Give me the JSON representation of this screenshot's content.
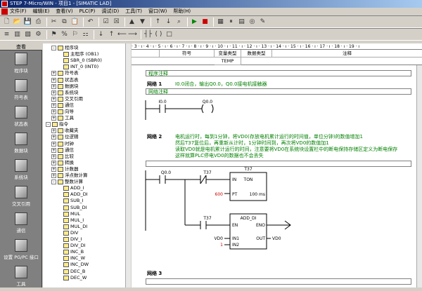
{
  "window": {
    "title": "STEP 7-Micro/WIN - 项目1 - [SIMATIC LAD]"
  },
  "menu": [
    "文件(F)",
    "编辑(E)",
    "查看(V)",
    "PLC(P)",
    "调试(D)",
    "工具(T)",
    "窗口(W)",
    "帮助(H)"
  ],
  "nav": {
    "header": "查看",
    "items": [
      {
        "label": "程序块",
        "icon": "program-block-icon"
      },
      {
        "label": "符号表",
        "icon": "symbol-table-icon"
      },
      {
        "label": "状态表",
        "icon": "status-table-icon"
      },
      {
        "label": "数据块",
        "icon": "data-block-icon"
      },
      {
        "label": "系统块",
        "icon": "system-block-icon"
      },
      {
        "label": "交叉引用",
        "icon": "cross-ref-icon"
      },
      {
        "label": "通信",
        "icon": "comm-icon"
      },
      {
        "label": "设置 PG/PC 接口",
        "icon": "pgpc-icon"
      },
      {
        "label": "工具",
        "icon": "tools-icon"
      }
    ]
  },
  "tree": [
    {
      "label": "程序块",
      "indent": 1,
      "exp": "-"
    },
    {
      "label": "主程序 (OB1)",
      "indent": 2
    },
    {
      "label": "SBR_0 (SBR0)",
      "indent": 2
    },
    {
      "label": "INT_0 (INT0)",
      "indent": 2
    },
    {
      "label": "符号表",
      "indent": 1,
      "exp": "+"
    },
    {
      "label": "状态表",
      "indent": 1,
      "exp": "+"
    },
    {
      "label": "数据块",
      "indent": 1,
      "exp": "+"
    },
    {
      "label": "系统块",
      "indent": 1,
      "exp": "+"
    },
    {
      "label": "交叉引用",
      "indent": 1,
      "exp": "+"
    },
    {
      "label": "通信",
      "indent": 1,
      "exp": "+"
    },
    {
      "label": "向导",
      "indent": 1,
      "exp": "+"
    },
    {
      "label": "工具",
      "indent": 1,
      "exp": "+"
    },
    {
      "label": "指令",
      "indent": 0,
      "exp": "-"
    },
    {
      "label": "收藏夹",
      "indent": 1,
      "exp": "+"
    },
    {
      "label": "位逻辑",
      "indent": 1,
      "exp": "+"
    },
    {
      "label": "时钟",
      "indent": 1,
      "exp": "+"
    },
    {
      "label": "通信",
      "indent": 1,
      "exp": "+"
    },
    {
      "label": "比较",
      "indent": 1,
      "exp": "+"
    },
    {
      "label": "转换",
      "indent": 1,
      "exp": "+"
    },
    {
      "label": "计数器",
      "indent": 1,
      "exp": "+"
    },
    {
      "label": "浮点数计算",
      "indent": 1,
      "exp": "+"
    },
    {
      "label": "整数计算",
      "indent": 1,
      "exp": "-"
    },
    {
      "label": "ADD_I",
      "indent": 2
    },
    {
      "label": "ADD_DI",
      "indent": 2
    },
    {
      "label": "SUB_I",
      "indent": 2
    },
    {
      "label": "SUB_DI",
      "indent": 2
    },
    {
      "label": "MUL",
      "indent": 2
    },
    {
      "label": "MUL_I",
      "indent": 2
    },
    {
      "label": "MUL_DI",
      "indent": 2
    },
    {
      "label": "DIV",
      "indent": 2
    },
    {
      "label": "DIV_I",
      "indent": 2
    },
    {
      "label": "DIV_DI",
      "indent": 2
    },
    {
      "label": "INC_B",
      "indent": 2
    },
    {
      "label": "INC_W",
      "indent": 2
    },
    {
      "label": "INC_DW",
      "indent": 2
    },
    {
      "label": "DEC_B",
      "indent": 2
    },
    {
      "label": "DEC_W",
      "indent": 2
    }
  ],
  "ruler": "· 3 · ı · 4 · ı · 5 · ı · 6 · ı · 7 · ı · 8 · ı · 9 · ı · 10 · ı · 11 · ı · 12 · ı · 13 · ı · 14 · ı · 15 · ı · 16 · ı · 17 · ı · 18 · ı · 19 · ı",
  "var_table": {
    "headers": [
      "符号",
      "变量类型",
      "数据类型",
      "注释"
    ],
    "row1_type": "TEMP"
  },
  "program": {
    "title": "程序注释",
    "net1": {
      "label": "网络 1",
      "comment": "I0.0闭合，输出Q0.0，Q0.0接电机接触器",
      "box": "网络注释",
      "contact": "I0.0",
      "coil": "Q0.0"
    },
    "net2": {
      "label": "网络 2",
      "comments": [
        "电机运行时，每到1分钟，将VD0(存放电机累计运行的时间值，单位分钟)的数值增加1",
        "然后T37复位后，再重新从计时，1分钟时间到，再次将VD0的数值加1",
        "读取VD0就是电机累计运行的时间，注意要将VD0在系统块设置栏中的断电保持存储区定义为断电保存",
        "这样就算PLC停电VD0的数据也不会丢失"
      ],
      "contact": "Q0.0",
      "nc_contact": "T37",
      "timer": {
        "name": "T37",
        "type": "TON",
        "in": "IN",
        "pt_pin": "PT",
        "pt_val": "600",
        "base": "100 ms"
      },
      "t37_contact": "T37",
      "add": {
        "type": "ADD_DI",
        "en": "EN",
        "eno": "ENO",
        "in1": "IN1",
        "in2": "IN2",
        "out": "OUT",
        "in1_val": "VD0",
        "in2_val": "1",
        "out_val": "VD0"
      }
    },
    "net3": {
      "label": "网络 3"
    }
  }
}
